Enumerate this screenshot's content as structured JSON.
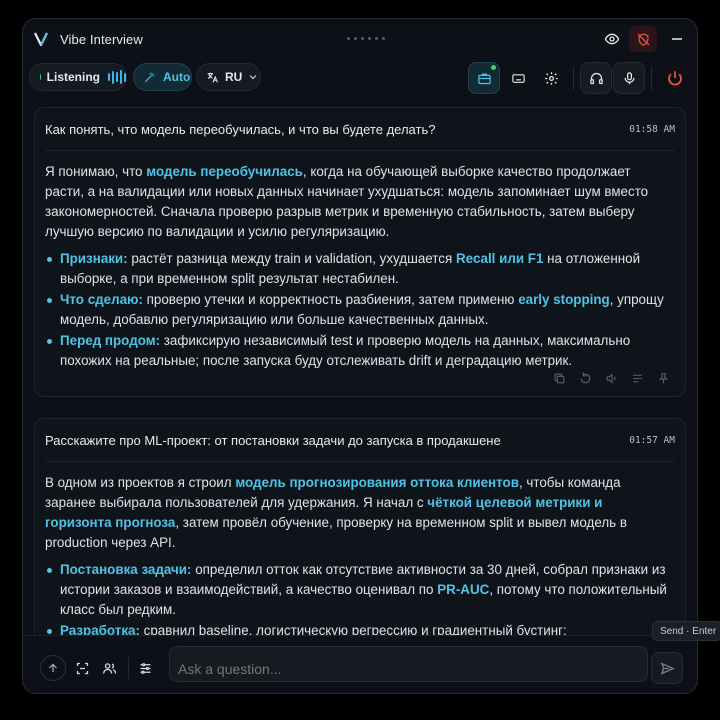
{
  "app": {
    "title": "Vibe Interview"
  },
  "toolbar": {
    "listening_label": "Listening",
    "auto_label": "Auto",
    "language": "RU"
  },
  "colors": {
    "accent": "#4fc3e6",
    "live": "#3fcf6e",
    "danger": "#e5533d"
  },
  "icons": [
    "eye-icon",
    "shield-off-icon",
    "minimize-icon",
    "wand-icon",
    "translate-icon",
    "chevron-down-icon",
    "briefcase-icon",
    "keyboard-icon",
    "gear-icon",
    "headphones-icon",
    "mic-icon",
    "power-icon",
    "copy-icon",
    "refresh-icon",
    "speaker-icon",
    "list-icon",
    "pin-icon",
    "arrow-up-icon",
    "scan-icon",
    "users-icon",
    "sliders-icon",
    "send-icon"
  ],
  "messages": [
    {
      "question": "Как понять, что модель переобучилась, и что вы будете делать?",
      "time": "01:58 AM",
      "intro_1": "Я понимаю, что ",
      "intro_hl": "модель переобучилась",
      "intro_2": ", когда на обучающей выборке качество продолжает расти, а на валидации или новых данных начинает ухудшаться: модель запоминает шум вместо закономерностей. Сначала проверю разрыв метрик и временную стабильность, затем выберу лучшую версию по валидации и усилю регуляризацию.",
      "bullets": [
        {
          "label": "Признаки:",
          "t1": " растёт разница между train и validation, ухудшается ",
          "hl": "Recall или F1",
          "t2": " на отложенной выборке, а при временном split результат нестабилен."
        },
        {
          "label": "Что сделаю:",
          "t1": " проверю утечки и корректность разбиения, затем применю ",
          "hl": "early stopping",
          "t2": ", упрощу модель, добавлю регуляризацию или больше качественных данных."
        },
        {
          "label": "Перед продом:",
          "t1": " зафиксирую независимый test и проверю модель на данных, максимально похожих на реальные; после запуска буду отслеживать drift и деградацию метрик.",
          "hl": "",
          "t2": ""
        }
      ]
    },
    {
      "question": "Расскажите про ML-проект: от постановки задачи до запуска в продакшене",
      "time": "01:57 AM",
      "intro_1": "В одном из проектов я строил ",
      "intro_hl": "модель прогнозирования оттока клиентов",
      "intro_2": ", чтобы команда заранее выбирала пользователей для удержания. Я начал с ",
      "intro_hl2": "чёткой целевой метрики и горизонта прогноза",
      "intro_3": ", затем провёл обучение, проверку на временном split и вывел модель в production через API.",
      "bullets": [
        {
          "label": "Постановка задачи:",
          "t1": " определил отток как отсутствие активности за 30 дней, собрал признаки из истории заказов и взаимодействий, а качество оценивал по ",
          "hl": "PR-AUC",
          "t2": ", потому что положительный класс был редким."
        },
        {
          "label": "Разработка:",
          "t1": " сравнил baseline, логистическую регрессию и градиентный бустинг;",
          "hl": "",
          "t2": ""
        }
      ]
    }
  ],
  "tooltip": {
    "send": "Send · Enter"
  },
  "composer": {
    "placeholder": "Ask a question..."
  }
}
